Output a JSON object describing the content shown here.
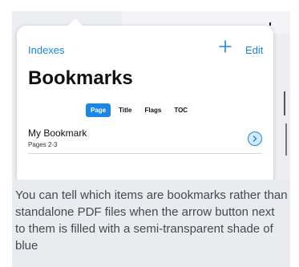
{
  "popover": {
    "back_label": "Indexes",
    "add_icon": "plus-icon",
    "edit_label": "Edit",
    "title": "Bookmarks",
    "segments": [
      {
        "label": "Page",
        "selected": true
      },
      {
        "label": "Title",
        "selected": false
      },
      {
        "label": "Flags",
        "selected": false
      },
      {
        "label": "TOC",
        "selected": false
      }
    ],
    "bookmarks": [
      {
        "title": "My Bookmark",
        "subtitle": "Pages 2-3",
        "icon": "chevron-right-circle-icon"
      }
    ]
  },
  "caption": "You can tell which items are bookmarks rather than standalone PDF files when the arrow button next to them is filled with a semi-transparent shade of blue",
  "colors": {
    "accent": "#1a86e6",
    "caption_bg": "#e9ebee",
    "caption_text": "#444a52"
  }
}
